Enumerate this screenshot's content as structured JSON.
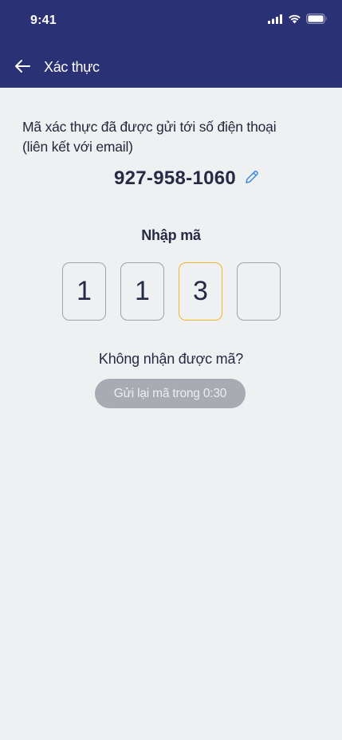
{
  "status_bar": {
    "time": "9:41",
    "icons": [
      "cellular-signal-icon",
      "wifi-icon",
      "battery-icon"
    ]
  },
  "nav": {
    "back_icon": "arrow-left-icon",
    "title": "Xác thực"
  },
  "message": {
    "line1": "Mã xác thực đã được gửi tới số điện thoại",
    "line2": "(liên kết với email)"
  },
  "phone": {
    "number": "927-958-1060",
    "edit_icon": "pencil-icon"
  },
  "code": {
    "label": "Nhập mã",
    "digits": [
      "1",
      "1",
      "3",
      ""
    ],
    "active_index": 2
  },
  "resend": {
    "prompt": "Không nhận được mã?",
    "button_label": "Gửi lại mã trong 0:30"
  },
  "colors": {
    "header": "#2b3175",
    "background": "#eff0f2",
    "active_border": "#f2b526",
    "edit_icon": "#3f8ae0",
    "disabled_button": "#a9abb3"
  }
}
